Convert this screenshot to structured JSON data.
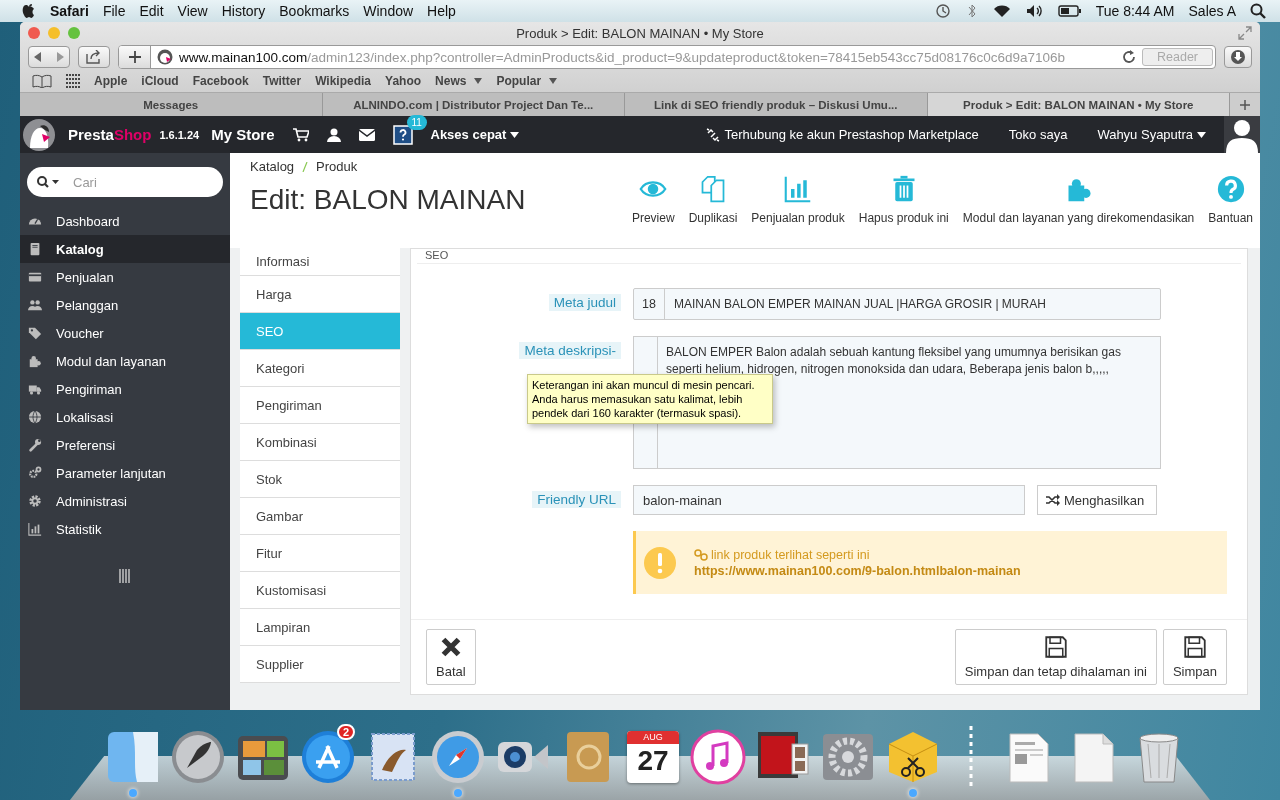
{
  "menubar": {
    "app": "Safari",
    "menus": [
      "File",
      "Edit",
      "View",
      "History",
      "Bookmarks",
      "Window",
      "Help"
    ],
    "clock": "Tue 8:44 AM",
    "user": "Sales A"
  },
  "browser": {
    "title": "Produk > Edit: BALON MAINAN • My Store",
    "url_host": "www.mainan100.com",
    "url_path": "/admin123/index.php?controller=AdminProducts&id_product=9&updateproduct&token=78415eb543cc75d08176c0c6d9a7106b",
    "reader": "Reader",
    "bookmarks": [
      {
        "label": "Apple",
        "menu": false
      },
      {
        "label": "iCloud",
        "menu": false
      },
      {
        "label": "Facebook",
        "menu": false
      },
      {
        "label": "Twitter",
        "menu": false
      },
      {
        "label": "Wikipedia",
        "menu": false
      },
      {
        "label": "Yahoo",
        "menu": false
      },
      {
        "label": "News",
        "menu": true
      },
      {
        "label": "Popular",
        "menu": true
      }
    ],
    "tabs": [
      {
        "label": "Messages",
        "selected": false
      },
      {
        "label": "ALNINDO.com | Distributor Project Dan Te...",
        "selected": false
      },
      {
        "label": "Link di SEO friendly produk – Diskusi Umu...",
        "selected": false
      },
      {
        "label": "Produk > Edit: BALON MAINAN • My Store",
        "selected": true
      }
    ]
  },
  "admin": {
    "brand_presta": "Presta",
    "brand_shop": "Shop",
    "version": "1.6.1.24",
    "store": "My Store",
    "help_badge": "11",
    "quick_access": "Akses cepat",
    "marketplace": "Terhubung ke akun Prestashop Marketplace",
    "my_shop": "Toko saya",
    "user": "Wahyu Syaputra"
  },
  "sidebar": {
    "search_placeholder": "Cari",
    "items": [
      {
        "label": "Dashboard",
        "kind": "gauge",
        "selected": false
      },
      {
        "label": "Katalog",
        "kind": "book",
        "selected": true
      },
      {
        "label": "Penjualan",
        "kind": "card",
        "selected": false
      },
      {
        "label": "Pelanggan",
        "kind": "users",
        "selected": false
      },
      {
        "label": "Voucher",
        "kind": "tag",
        "selected": false
      },
      {
        "label": "Modul dan layanan",
        "kind": "puzzle",
        "selected": false
      },
      {
        "label": "Pengiriman",
        "kind": "truck",
        "selected": false
      },
      {
        "label": "Lokalisasi",
        "kind": "globe",
        "selected": false
      },
      {
        "label": "Preferensi",
        "kind": "wrench",
        "selected": false
      },
      {
        "label": "Parameter lanjutan",
        "kind": "cogs",
        "selected": false
      },
      {
        "label": "Administrasi",
        "kind": "gear",
        "selected": false
      },
      {
        "label": "Statistik",
        "kind": "chart",
        "selected": false
      }
    ]
  },
  "header": {
    "breadcrumb": [
      "Katalog",
      "Produk"
    ],
    "title": "Edit: BALON MAINAN",
    "actions": [
      {
        "label": "Preview",
        "kind": "eye"
      },
      {
        "label": "Duplikasi",
        "kind": "copy"
      },
      {
        "label": "Penjualan produk",
        "kind": "chart"
      },
      {
        "label": "Hapus produk ini",
        "kind": "trash"
      },
      {
        "label": "Modul dan layanan yang direkomendasikan",
        "kind": "puzzle"
      },
      {
        "label": "Bantuan",
        "kind": "help"
      }
    ]
  },
  "product_tabs": [
    {
      "label": "Informasi",
      "selected": false
    },
    {
      "label": "Harga",
      "selected": false
    },
    {
      "label": "SEO",
      "selected": true
    },
    {
      "label": "Kategori",
      "selected": false
    },
    {
      "label": "Pengiriman",
      "selected": false
    },
    {
      "label": "Kombinasi",
      "selected": false
    },
    {
      "label": "Stok",
      "selected": false
    },
    {
      "label": "Gambar",
      "selected": false
    },
    {
      "label": "Fitur",
      "selected": false
    },
    {
      "label": "Kustomisasi",
      "selected": false
    },
    {
      "label": "Lampiran",
      "selected": false
    },
    {
      "label": "Supplier",
      "selected": false
    }
  ],
  "seo": {
    "section_title": "SEO",
    "meta_title": {
      "label": "Meta judul",
      "count": "18",
      "value": "MAINAN BALON EMPER MAINAN JUAL |HARGA GROSIR | MURAH"
    },
    "meta_description": {
      "label": "Meta deskripsi-",
      "value": "BALON EMPER Balon adalah sebuah kantung fleksibel yang umumnya berisikan gas seperti helium, hidrogen, nitrogen monoksida dan udara, Beberapa jenis balon b,,,,,",
      "tooltip": "Keterangan ini akan muncul di mesin pencari. Anda harus memasukan satu kalimat, lebih pendek dari 160 karakter (termasuk spasi)."
    },
    "friendly_url": {
      "label": "Friendly URL",
      "value": "balon-mainan",
      "button": "Menghasilkan"
    },
    "alert": {
      "text": "link produk terlihat seperti ini",
      "url": "https://www.mainan100.com/9-balon.htmlbalon-mainan"
    }
  },
  "footer_buttons": [
    {
      "label": "Batal",
      "kind": "close"
    },
    {
      "label": "Simpan dan tetap dihalaman ini",
      "kind": "save"
    },
    {
      "label": "Simpan",
      "kind": "save"
    }
  ],
  "dock": [
    {
      "kind": "finder",
      "running": true
    },
    {
      "kind": "rocket",
      "running": false
    },
    {
      "kind": "photos",
      "running": false
    },
    {
      "kind": "appstore",
      "running": false,
      "badge": "2"
    },
    {
      "kind": "mail",
      "running": false
    },
    {
      "kind": "safari",
      "running": true
    },
    {
      "kind": "camera",
      "running": false
    },
    {
      "kind": "contacts",
      "running": false
    },
    {
      "kind": "calendar",
      "running": false,
      "month": "AUG",
      "day": "27"
    },
    {
      "kind": "music",
      "running": false
    },
    {
      "kind": "photobooth",
      "running": false
    },
    {
      "kind": "settings",
      "running": false
    },
    {
      "kind": "archive",
      "running": true
    },
    {
      "kind": "separator"
    },
    {
      "kind": "document",
      "running": false
    },
    {
      "kind": "blank",
      "running": false
    },
    {
      "kind": "trash",
      "running": false
    }
  ]
}
